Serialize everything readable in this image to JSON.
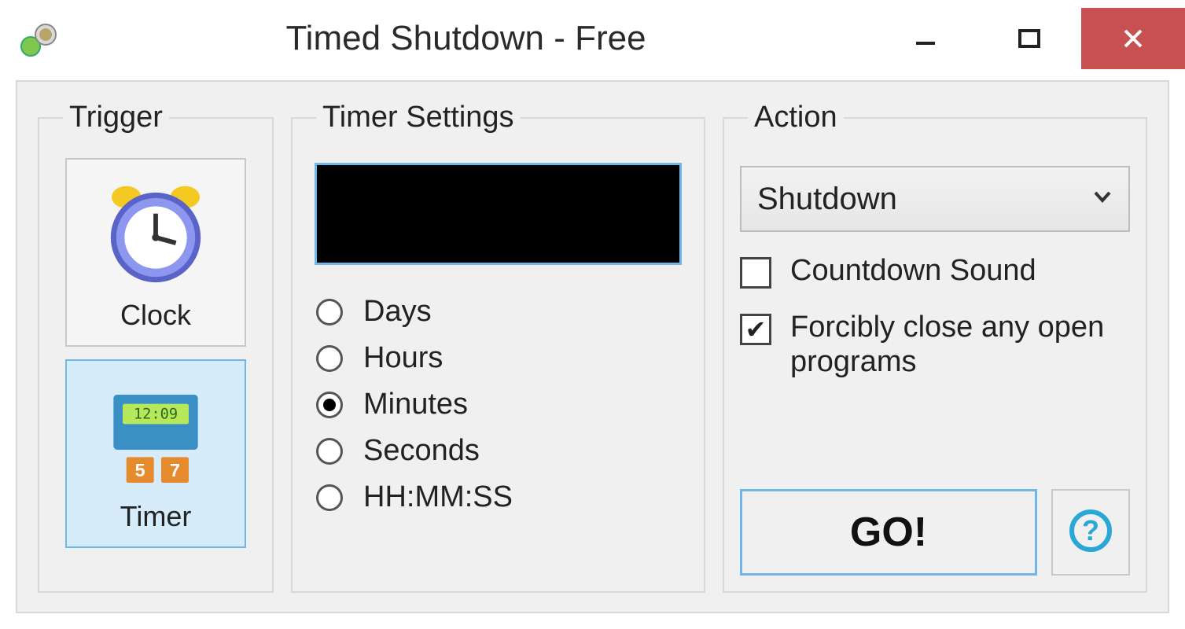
{
  "window": {
    "title": "Timed Shutdown - Free"
  },
  "trigger": {
    "legend": "Trigger",
    "clock_label": "Clock",
    "timer_label": "Timer",
    "selected": "timer"
  },
  "timer_settings": {
    "legend": "Timer Settings",
    "display_value": "",
    "units": {
      "days": "Days",
      "hours": "Hours",
      "minutes": "Minutes",
      "seconds": "Seconds",
      "hhmmss": "HH:MM:SS"
    },
    "selected_unit": "minutes"
  },
  "action": {
    "legend": "Action",
    "dropdown_value": "Shutdown",
    "countdown_sound_label": "Countdown Sound",
    "countdown_sound_checked": false,
    "force_close_label": "Forcibly close any open programs",
    "force_close_checked": true,
    "go_label": "GO!"
  }
}
